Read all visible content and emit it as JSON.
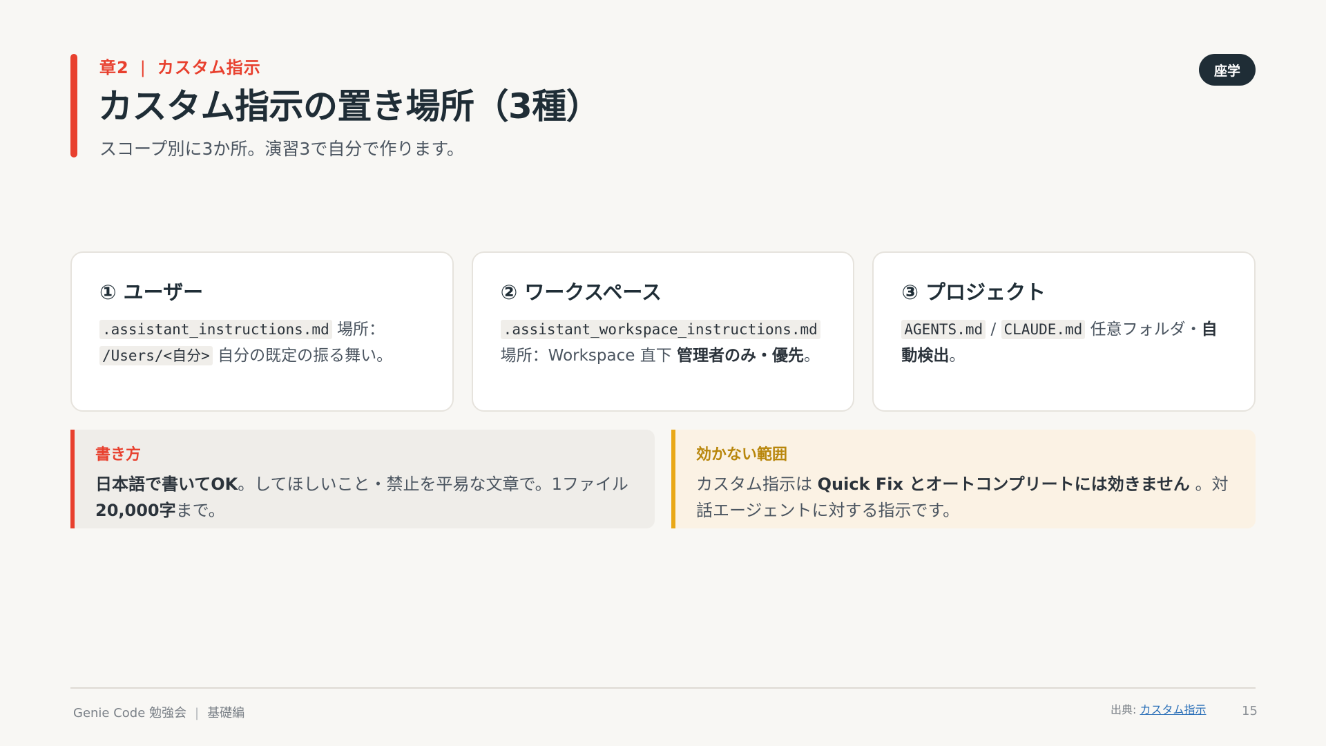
{
  "header": {
    "chapter_num": "章2",
    "chapter_sep": "|",
    "chapter_name": "カスタム指示",
    "title": "カスタム指示の置き場所（3種）",
    "subtitle": "スコープ別に3か所。演習3で自分で作ります。",
    "badge": "座学"
  },
  "cards": [
    {
      "title": "① ユーザー",
      "code1": ".assistant_instructions.md",
      "text1": " 場所：",
      "code2": "/Users/<自分>",
      "text2": " 自分の既定の振る舞い。"
    },
    {
      "title": "② ワークスペース",
      "code1": ".assistant_workspace_instructions.md",
      "text1": " 場所：Workspace 直下 ",
      "bold1": "管理者のみ・優先",
      "text2": "。"
    },
    {
      "title": "③ プロジェクト",
      "code1": "AGENTS.md",
      "text1": " / ",
      "code2": "CLAUDE.md",
      "text2": " 任意フォルダ・",
      "bold1": "自動検出",
      "text3": "。"
    }
  ],
  "callouts": {
    "writing": {
      "title": "書き方",
      "bold1": "日本語で書いてOK",
      "text1": "。してほしいこと・禁止を平易な文章で。1ファイル ",
      "bold2": "20,000字",
      "text2": "まで。"
    },
    "scope": {
      "title": "効かない範囲",
      "text1": "カスタム指示は ",
      "bold1": "Quick Fix とオートコンプリートには効きません",
      "text2": " 。対話エージェントに対する指示です。"
    }
  },
  "footer": {
    "left_title": "Genie Code 勉強会",
    "left_sep": "|",
    "left_sub": "基礎編",
    "source_label": "出典: ",
    "source_link": "カスタム指示",
    "page_number": "15"
  },
  "colors": {
    "accent": "#e8402e",
    "amber": "#e9a817",
    "dark": "#1f2d36",
    "background": "#f8f7f4"
  }
}
